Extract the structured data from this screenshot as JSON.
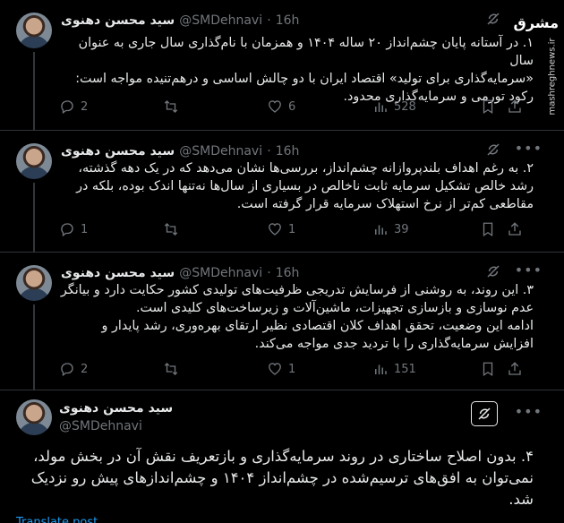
{
  "tweets": [
    {
      "name": "سید محسن دهنوی",
      "handle": "@SMDehnavi",
      "dot": "·",
      "time": "16h",
      "lines": [
        "۱. در آستانه پایان چشم‌انداز ۲۰ ساله ۱۴۰۴ و همزمان با نام‌گذاری سال جاری به عنوان سال",
        "«سرمایه‌گذاری برای تولید» اقتصاد ایران با دو چالش اساسی و درهم‌تنیده مواجه است:",
        "رکود تورمی و سرمایه‌گذاری محدود."
      ],
      "replies": "2",
      "retweets": "",
      "likes": "6",
      "views": "528"
    },
    {
      "name": "سید محسن دهنوی",
      "handle": "@SMDehnavi",
      "dot": "·",
      "time": "16h",
      "lines": [
        "۲. به رغم اهداف بلندپروازانه چشم‌انداز، بررسی‌ها نشان می‌دهد که در یک دهه گذشته،",
        "رشد خالص تشکیل سرمایه ثابت ناخالص در بسیاری از سال‌ها نه‌تنها اندک بوده، بلکه در",
        "مقاطعی کم‌تر از نرخ استهلاک سرمایه قرار گرفته است."
      ],
      "replies": "1",
      "retweets": "",
      "likes": "1",
      "views": "39"
    },
    {
      "name": "سید محسن دهنوی",
      "handle": "@SMDehnavi",
      "dot": "·",
      "time": "16h",
      "lines": [
        "۳. این روند، به روشنی از فرسایش تدریجی ظرفیت‌های تولیدی کشور حکایت دارد و بیانگر",
        "عدم نوسازی و بازسازی تجهیزات، ماشین‌آلات و زیرساخت‌های کلیدی است.",
        "ادامه این وضعیت، تحقق اهداف کلان اقتصادی نظیر ارتقای بهره‌وری، رشد پایدار و",
        "افزایش سرمایه‌گذاری را با تردید جدی مواجه می‌کند."
      ],
      "replies": "2",
      "retweets": "",
      "likes": "1",
      "views": "151"
    }
  ],
  "last_tweet": {
    "name": "سید محسن دهنوی",
    "handle": "@SMDehnavi",
    "lines": [
      "۴. بدون اصلاح ساختاری در روند سرمایه‌گذاری و بازتعریف نقش آن در بخش مولد،",
      "نمی‌توان به افق‌های ترسیم‌شده در چشم‌انداز ۱۴۰۴ و چشم‌اندازهای پیش رو نزدیک",
      "شد."
    ],
    "translate": "Translate post"
  },
  "watermark": {
    "logo": "مشرق",
    "url": "mashreghnews.ir"
  },
  "icons": [
    "grok-icon",
    "more-icon",
    "reply-icon",
    "retweet-icon",
    "like-icon",
    "views-icon",
    "bookmark-icon",
    "share-icon"
  ],
  "colors": {
    "background": "#000000",
    "text": "#e7e9ea",
    "muted": "#71767b",
    "link": "#1d9bf0",
    "divider": "#2f3336"
  }
}
